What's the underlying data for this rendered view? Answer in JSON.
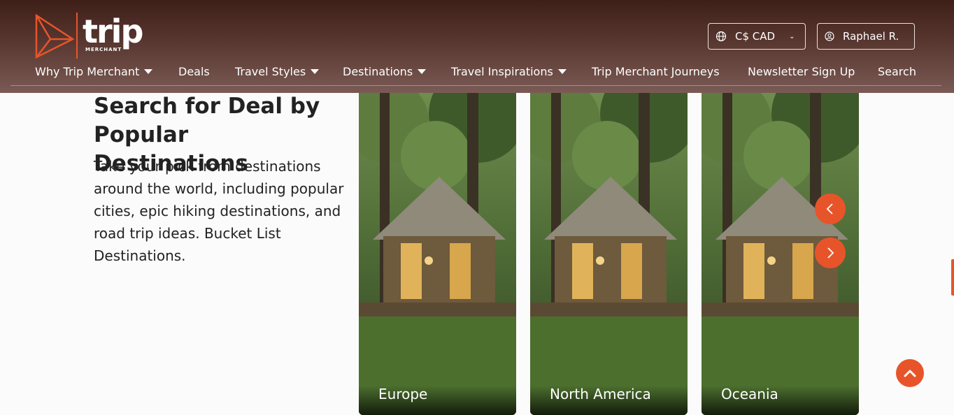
{
  "header": {
    "logo_text": "trip",
    "logo_sub": "MERCHANT",
    "currency": "C$ CAD",
    "user": "Raphael R.",
    "nav": [
      {
        "label": "Why Trip Merchant",
        "has_dropdown": true
      },
      {
        "label": "Deals",
        "has_dropdown": false
      },
      {
        "label": "Travel Styles",
        "has_dropdown": true
      },
      {
        "label": "Destinations",
        "has_dropdown": true
      },
      {
        "label": "Travel Inspirations",
        "has_dropdown": true
      },
      {
        "label": "Trip Merchant Journeys",
        "has_dropdown": false
      },
      {
        "label": "Newsletter Sign Up",
        "has_dropdown": false
      },
      {
        "label": "Search",
        "has_dropdown": false
      }
    ]
  },
  "section": {
    "headline": "Search for Deal by Popular Destinations",
    "description": "Take your pick from destinations around the world, including popular cities, epic hiking destinations, and road trip ideas. Bucket List Destinations."
  },
  "cards": [
    {
      "label": "Europe"
    },
    {
      "label": "North America"
    },
    {
      "label": "Oceania"
    }
  ],
  "colors": {
    "accent": "#e8542a",
    "header_bg": "#55342d"
  },
  "icons": {
    "currency": "globe-icon",
    "user": "user-circle-icon",
    "prev": "chevron-left-icon",
    "next": "chevron-right-icon",
    "scroll_top": "chevron-up-icon"
  }
}
